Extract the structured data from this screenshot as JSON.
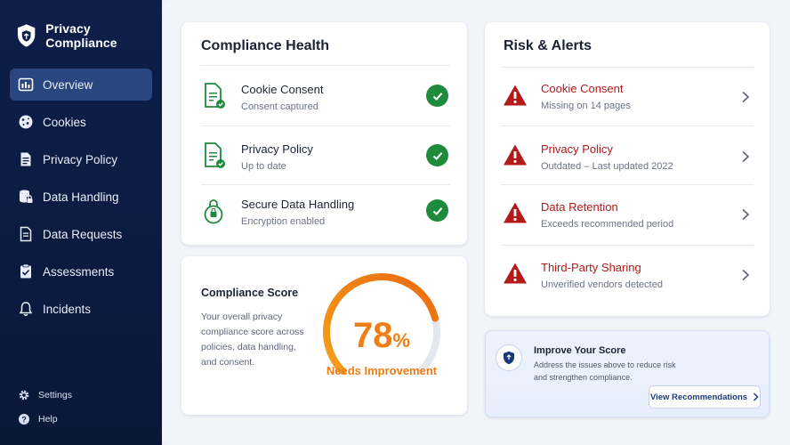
{
  "app": {
    "title": "Privacy Compliance"
  },
  "sidebar": {
    "items": [
      {
        "label": "Overview",
        "icon": "overview-icon",
        "active": true
      },
      {
        "label": "Cookies",
        "icon": "cookie-icon",
        "active": false
      },
      {
        "label": "Privacy Policy",
        "icon": "document-icon",
        "active": false
      },
      {
        "label": "Data Handling",
        "icon": "database-lock-icon",
        "active": false
      },
      {
        "label": "Data Requests",
        "icon": "file-list-icon",
        "active": false
      },
      {
        "label": "Assessments",
        "icon": "clipboard-check-icon",
        "active": false
      },
      {
        "label": "Incidents",
        "icon": "bell-icon",
        "active": false
      }
    ],
    "footer": [
      {
        "label": "Settings",
        "icon": "gear-icon"
      },
      {
        "label": "Help",
        "icon": "help-icon"
      }
    ]
  },
  "health": {
    "title": "Compliance Health",
    "items": [
      {
        "title": "Cookie Consent",
        "subtitle": "Consent captured",
        "icon": "document-check-icon",
        "status": "ok"
      },
      {
        "title": "Privacy Policy",
        "subtitle": "Up to date",
        "icon": "document-check-icon",
        "status": "ok"
      },
      {
        "title": "Secure Data Handling",
        "subtitle": "Encryption enabled",
        "icon": "lock-icon",
        "status": "ok"
      }
    ]
  },
  "score": {
    "title": "Compliance Score",
    "description": "Your overall privacy compliance score across policies, data handling, and consent.",
    "value": "78",
    "unit": "%",
    "fraction": 0.78,
    "label": "Needs Improvement"
  },
  "risk": {
    "title": "Risk & Alerts",
    "alerts": [
      {
        "title": "Cookie Consent",
        "subtitle": "Missing on 14 pages"
      },
      {
        "title": "Privacy Policy",
        "subtitle": "Outdated – Last updated 2022"
      },
      {
        "title": "Data Retention",
        "subtitle": "Exceeds recommended period"
      },
      {
        "title": "Third-Party Sharing",
        "subtitle": "Unverified vendors detected"
      }
    ]
  },
  "improve": {
    "title": "Improve Your Score",
    "description": "Address the issues above to reduce risk and strengthen compliance.",
    "button": "View Recommendations"
  },
  "colors": {
    "sidebar": "#0d1f4a",
    "active": "#2a4681",
    "ok": "#1e8a3c",
    "alert": "#b31a1a",
    "gauge": "#ef7d14"
  }
}
